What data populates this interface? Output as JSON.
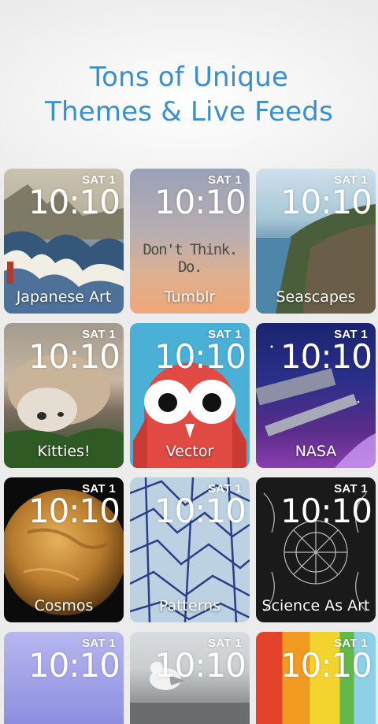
{
  "header": {
    "line1": "Tons of Unique",
    "line2": "Themes & Live Feeds"
  },
  "colors": {
    "headline": "#3a8fd0",
    "background": "#f2f2f2"
  },
  "tiles": [
    {
      "day": "SAT 1",
      "time": "10:10",
      "label": "Japanese Art"
    },
    {
      "day": "SAT 1",
      "time": "10:10",
      "label": "Tumblr",
      "quote": "Don't Think. Do."
    },
    {
      "day": "SAT 1",
      "time": "10:10",
      "label": "Seascapes"
    },
    {
      "day": "SAT 1",
      "time": "10:10",
      "label": "Kitties!"
    },
    {
      "day": "SAT 1",
      "time": "10:10",
      "label": "Vector"
    },
    {
      "day": "SAT 1",
      "time": "10:10",
      "label": "NASA"
    },
    {
      "day": "SAT 1",
      "time": "10:10",
      "label": "Cosmos"
    },
    {
      "day": "SAT 1",
      "time": "10:10",
      "label": "Patterns"
    },
    {
      "day": "SAT 1",
      "time": "10:10",
      "label": "Science As Art"
    },
    {
      "day": "SAT 1",
      "time": "10:10"
    },
    {
      "day": "SAT 1",
      "time": "10:10"
    },
    {
      "day": "SAT 1",
      "time": "10:10"
    }
  ]
}
